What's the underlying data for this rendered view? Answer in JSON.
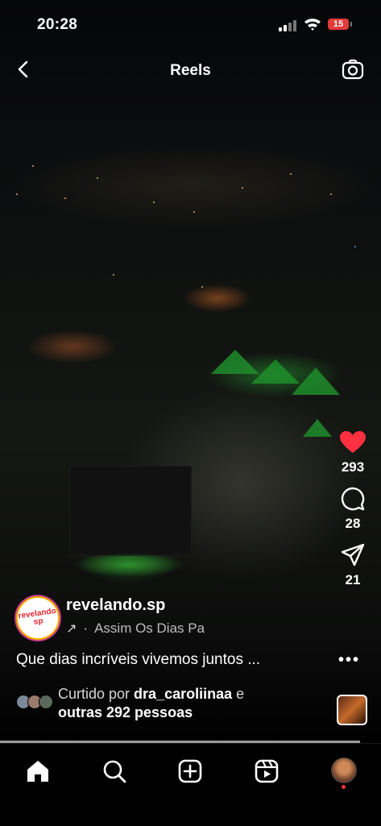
{
  "status_bar": {
    "time": "20:28",
    "battery": "15"
  },
  "header": {
    "title": "Reels"
  },
  "actions": {
    "likes": "293",
    "comments": "28",
    "shares": "21"
  },
  "post": {
    "handle": "revelando.sp",
    "logo_text": "revelando sp",
    "audio": "Assim Os Dias Pa",
    "caption": "Que dias incríveis vivemos juntos ...",
    "liked_prefix": "Curtido por ",
    "liked_user": "dra_caroliinaa",
    "liked_mid": " e",
    "liked_rest": "outras 292 pessoas"
  },
  "colors": {
    "like_red": "#ff3040",
    "battery_red": "#e23b3b",
    "tent_green": "#1f8c2b"
  },
  "icons": [
    "back-arrow-icon",
    "camera-icon",
    "heart-icon",
    "comment-icon",
    "share-icon",
    "more-icon",
    "home-icon",
    "search-icon",
    "create-icon",
    "reels-icon",
    "profile-avatar"
  ]
}
